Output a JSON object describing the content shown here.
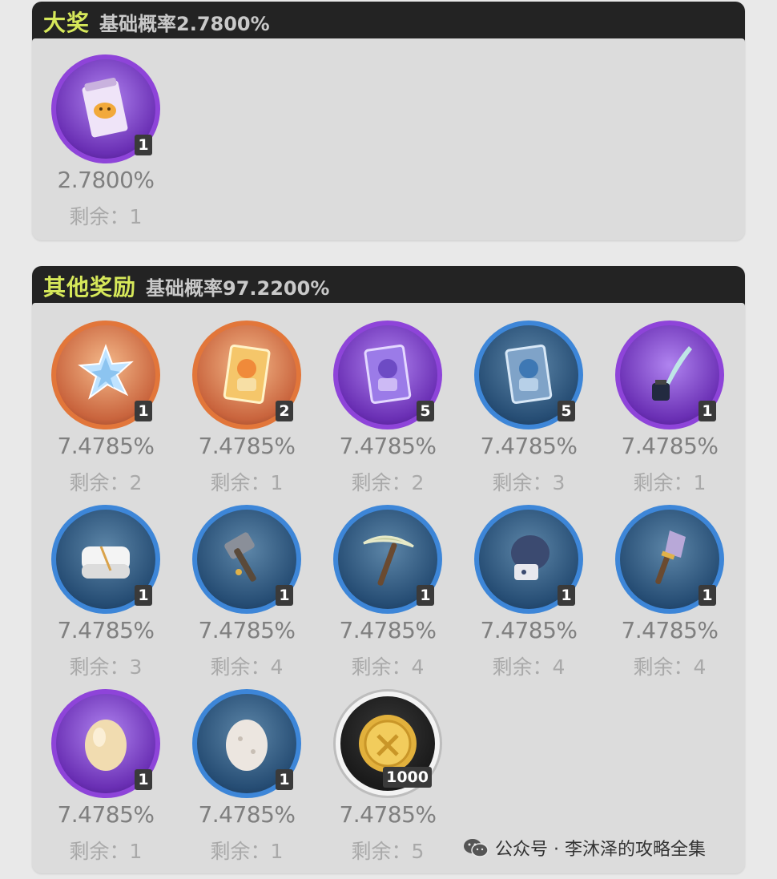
{
  "grand": {
    "title": "大奖",
    "rate": "基础概率2.7800%",
    "items": [
      {
        "icon": "ticket-icon",
        "tier": "purple",
        "count": "1",
        "prob": "2.7800%",
        "remain": "剩余：1"
      }
    ]
  },
  "other": {
    "title": "其他奖励",
    "rate": "基础概率97.2200%",
    "items": [
      {
        "icon": "crystal-icon",
        "tier": "orange",
        "count": "1",
        "prob": "7.4785%",
        "remain": "剩余：2"
      },
      {
        "icon": "gold-card-icon",
        "tier": "orange",
        "count": "2",
        "prob": "7.4785%",
        "remain": "剩余：1"
      },
      {
        "icon": "purple-card-icon",
        "tier": "purple",
        "count": "5",
        "prob": "7.4785%",
        "remain": "剩余：2"
      },
      {
        "icon": "blue-card-icon",
        "tier": "blue",
        "count": "5",
        "prob": "7.4785%",
        "remain": "剩余：3"
      },
      {
        "icon": "quill-ink-icon",
        "tier": "purple",
        "count": "1",
        "prob": "7.4785%",
        "remain": "剩余：1"
      },
      {
        "icon": "towel-icon",
        "tier": "blue",
        "count": "1",
        "prob": "7.4785%",
        "remain": "剩余：3"
      },
      {
        "icon": "hammer-icon",
        "tier": "blue",
        "count": "1",
        "prob": "7.4785%",
        "remain": "剩余：4"
      },
      {
        "icon": "pickaxe-icon",
        "tier": "blue",
        "count": "1",
        "prob": "7.4785%",
        "remain": "剩余：4"
      },
      {
        "icon": "glove-icon",
        "tier": "blue",
        "count": "1",
        "prob": "7.4785%",
        "remain": "剩余：4"
      },
      {
        "icon": "shovel-icon",
        "tier": "blue",
        "count": "1",
        "prob": "7.4785%",
        "remain": "剩余：4"
      },
      {
        "icon": "yellow-egg-icon",
        "tier": "purple",
        "count": "1",
        "prob": "7.4785%",
        "remain": "剩余：1"
      },
      {
        "icon": "white-egg-icon",
        "tier": "blue",
        "count": "1",
        "prob": "7.4785%",
        "remain": "剩余：1"
      },
      {
        "icon": "gold-coin-icon",
        "tier": "gold",
        "count": "1000",
        "prob": "7.4785%",
        "remain": "剩余：5"
      }
    ]
  },
  "watermark": {
    "text": "公众号 · 李沐泽的攻略全集",
    "icon": "wechat-icon"
  },
  "colors": {
    "header_bg": "#232323",
    "title_accent": "#d6e85a",
    "orange_ring": "#e2763a",
    "purple_ring": "#8e44d9",
    "blue_ring": "#3d86d8"
  }
}
